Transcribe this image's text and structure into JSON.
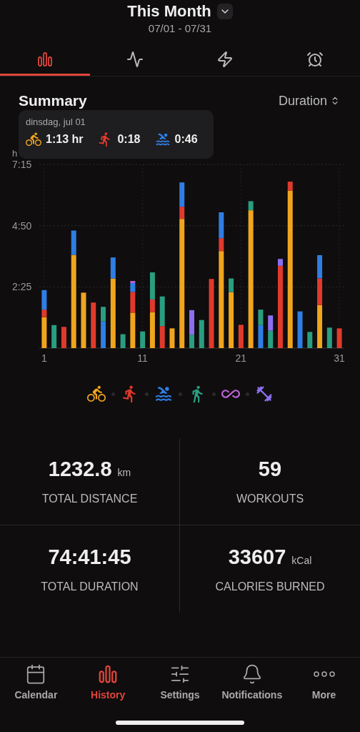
{
  "header": {
    "title": "This Month",
    "range": "07/01 - 07/31"
  },
  "tabs": [
    {
      "kind": "bars",
      "selected": true
    },
    {
      "kind": "pulse",
      "selected": false
    },
    {
      "kind": "bolt",
      "selected": false
    },
    {
      "kind": "alarm",
      "selected": false
    }
  ],
  "summary": {
    "title": "Summary",
    "sort": "Duration"
  },
  "tooltip": {
    "date": "dinsdag, jul 01",
    "entries": [
      {
        "kind": "cycling",
        "value": "1:13 hr"
      },
      {
        "kind": "running",
        "value": "0:18"
      },
      {
        "kind": "swimming",
        "value": "0:46"
      }
    ]
  },
  "chart_data": {
    "type": "bar",
    "stacked": true,
    "ylabel": "h",
    "x": [
      1,
      2,
      3,
      4,
      5,
      6,
      7,
      8,
      9,
      10,
      11,
      12,
      13,
      14,
      15,
      16,
      17,
      18,
      19,
      20,
      21,
      22,
      23,
      24,
      25,
      26,
      27,
      28,
      29,
      30,
      31
    ],
    "xticks": [
      1,
      11,
      21,
      31
    ],
    "xlim": [
      0.5,
      31.5
    ],
    "ylim": [
      0,
      7.25
    ],
    "grid": true,
    "yticks": [
      {
        "value": 2.4167,
        "label": "2:25"
      },
      {
        "value": 4.8333,
        "label": "4:50"
      },
      {
        "value": 7.25,
        "label": "7:15"
      }
    ],
    "series": [
      {
        "color": "#f0a51e",
        "values": [
          1.22,
          0,
          0,
          3.68,
          2.19,
          0,
          0,
          2.75,
          0,
          1.4,
          0,
          1.42,
          0,
          0.78,
          5.1,
          0,
          0,
          0,
          3.83,
          2.21,
          0,
          5.44,
          0,
          0,
          0,
          6.22,
          0,
          0,
          1.7,
          0,
          0
        ]
      },
      {
        "color": "#e03a2c",
        "values": [
          0.3,
          0,
          0.84,
          0,
          0,
          1.8,
          0,
          0,
          0,
          0.82,
          0,
          0.5,
          0.87,
          0,
          0.48,
          0,
          0,
          2.73,
          0.51,
          0,
          0.92,
          0,
          0,
          0,
          3.25,
          0.35,
          0,
          0,
          1.05,
          0,
          0.78
        ]
      },
      {
        "color": "#2f7ee3",
        "values": [
          0.77,
          0,
          0,
          0.96,
          0,
          0,
          1.06,
          0.83,
          0,
          0.35,
          0,
          0,
          0,
          0,
          0.96,
          0,
          0,
          0,
          1.02,
          0,
          0,
          0,
          0.91,
          0,
          0,
          0,
          1.45,
          0,
          0.92,
          0,
          0
        ]
      },
      {
        "color": "#2a9e80",
        "values": [
          0,
          0.91,
          0,
          0,
          0,
          0,
          0.57,
          0,
          0.55,
          0,
          0.66,
          1.07,
          1.17,
          0,
          0,
          0.53,
          1.11,
          0,
          0,
          0.54,
          0,
          0.36,
          0.61,
          0.69,
          0,
          0,
          0,
          0.64,
          0,
          0.81,
          0
        ]
      },
      {
        "color": "#c064d8",
        "values": [
          0,
          0,
          0,
          0,
          0,
          0,
          0,
          0,
          0,
          0.08,
          0,
          0,
          0,
          0,
          0,
          0,
          0,
          0,
          0,
          0,
          0,
          0,
          0,
          0,
          0,
          0,
          0,
          0,
          0,
          0,
          0
        ]
      },
      {
        "color": "#8c6ff0",
        "values": [
          0,
          0,
          0,
          0,
          0,
          0,
          0,
          0,
          0,
          0,
          0,
          0,
          0,
          0,
          0,
          0.97,
          0,
          0,
          0,
          0,
          0,
          0,
          0,
          0.6,
          0.27,
          0,
          0,
          0,
          0,
          0,
          0
        ]
      }
    ]
  },
  "legend": [
    {
      "kind": "cycling",
      "color": "#f0a51e"
    },
    {
      "kind": "running",
      "color": "#e03a2c"
    },
    {
      "kind": "swimming",
      "color": "#2f7ee3"
    },
    {
      "kind": "walking",
      "color": "#2a9e80"
    },
    {
      "kind": "other",
      "color": "#c064d8"
    },
    {
      "kind": "strength",
      "color": "#8c6ff0"
    }
  ],
  "stats": [
    {
      "value": "1232.8",
      "unit": "km",
      "label": "TOTAL DISTANCE"
    },
    {
      "value": "59",
      "label": "WORKOUTS"
    },
    {
      "value": "74:41:45",
      "label": "TOTAL DURATION"
    },
    {
      "value": "33607",
      "unit": "kCal",
      "label": "CALORIES BURNED"
    }
  ],
  "nav": [
    {
      "kind": "calendar",
      "label": "Calendar",
      "selected": false
    },
    {
      "kind": "history",
      "label": "History",
      "selected": true
    },
    {
      "kind": "settings",
      "label": "Settings",
      "selected": false
    },
    {
      "kind": "bell",
      "label": "Notifications",
      "selected": false
    },
    {
      "kind": "more",
      "label": "More",
      "selected": false
    }
  ]
}
